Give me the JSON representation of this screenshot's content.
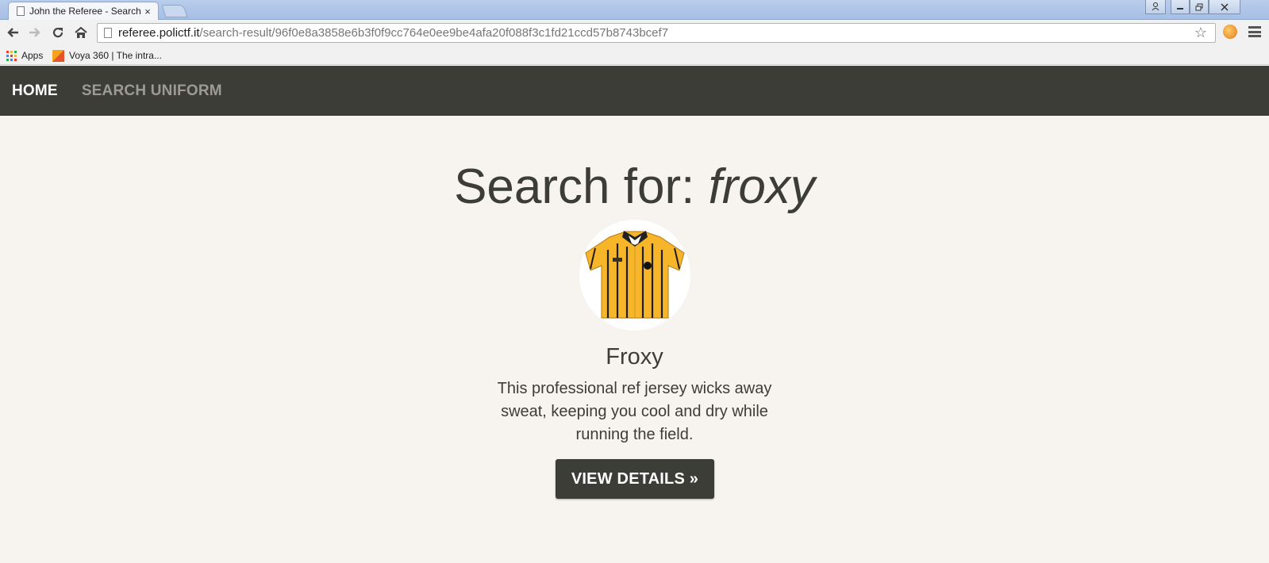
{
  "browser": {
    "tab_title": "John the Referee - Search",
    "tab_close": "×",
    "url_host": "referee.polictf.it",
    "url_path": "/search-result/96f0e8a3858e6b3f0f9cc764e0ee9be4afa20f088f3c1fd21ccd57b8743bcef7",
    "back_icon": "back-arrow-icon",
    "forward_icon": "forward-arrow-icon",
    "reload_icon": "reload-icon",
    "home_icon": "home-icon",
    "bookmarks": [
      {
        "label": "Apps",
        "icon": "apps-grid-icon"
      },
      {
        "label": "Voya 360 | The intra...",
        "icon": "voya-icon"
      }
    ]
  },
  "site": {
    "nav": {
      "home": "HOME",
      "search_uniform": "SEARCH UNIFORM"
    },
    "search": {
      "prefix": "Search for: ",
      "query": "froxy"
    },
    "product": {
      "name": "Froxy",
      "description": "This professional ref jersey wicks away sweat, keeping you cool and dry while running the field.",
      "button": "VIEW DETAILS »",
      "image_icon": "referee-jersey-image"
    },
    "colors": {
      "nav_bg": "#3d3d38",
      "page_bg": "#f7f4ef",
      "jersey_yellow": "#f7b52a",
      "button_bg": "#3d3d38"
    }
  }
}
